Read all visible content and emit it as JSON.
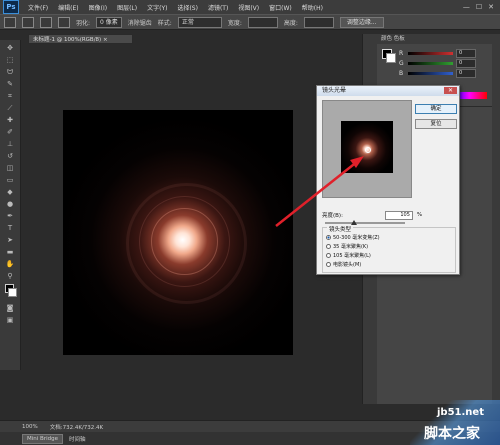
{
  "app": {
    "logo": "Ps"
  },
  "menubar": {
    "items": [
      "文件(F)",
      "编辑(E)",
      "图像(I)",
      "图层(L)",
      "文字(Y)",
      "选择(S)",
      "滤镜(T)",
      "视图(V)",
      "窗口(W)",
      "帮助(H)"
    ],
    "window_controls": [
      "—",
      "☐",
      "✕"
    ]
  },
  "options_bar": {
    "feather_label": "羽化:",
    "feather_value": "0 像素",
    "antialias_label": "消除锯齿",
    "style_label": "样式:",
    "style_value": "正常",
    "width_label": "宽度:",
    "height_label": "高度:",
    "refine_button": "调整边缘..."
  },
  "document": {
    "tab_title": "未标题-1 @ 100%(RGB/8) ×"
  },
  "status_bar": {
    "zoom": "100%",
    "doc_info": "文档:732.4K/732.4K",
    "tabs": [
      "Mini Bridge",
      "时间轴"
    ]
  },
  "right_panel": {
    "tabs": "颜色  色板",
    "sliders": [
      {
        "label": "R",
        "value": "0",
        "color": "#d03030"
      },
      {
        "label": "G",
        "value": "0",
        "color": "#30a030"
      },
      {
        "label": "B",
        "value": "0",
        "color": "#3060d0"
      }
    ]
  },
  "dialog": {
    "title": "镜头光晕",
    "close": "✕",
    "ok_button": "确定",
    "cancel_button": "复位",
    "brightness_label": "亮度(B):",
    "brightness_value": "105",
    "brightness_unit": "%",
    "brightness_level": 105,
    "lens_group_title": "镜头类型",
    "lens_options": [
      {
        "label": "50-300 毫米变焦(Z)",
        "selected": true
      },
      {
        "label": "35 毫米聚焦(K)",
        "selected": false
      },
      {
        "label": "105 毫米聚焦(L)",
        "selected": false
      },
      {
        "label": "电影镜头(M)",
        "selected": false
      }
    ]
  },
  "watermark": {
    "line1": "jb51.net",
    "line2": "脚本之家"
  },
  "colors": {
    "arrow": "#e0202a",
    "accent": "#3b8ed8"
  }
}
